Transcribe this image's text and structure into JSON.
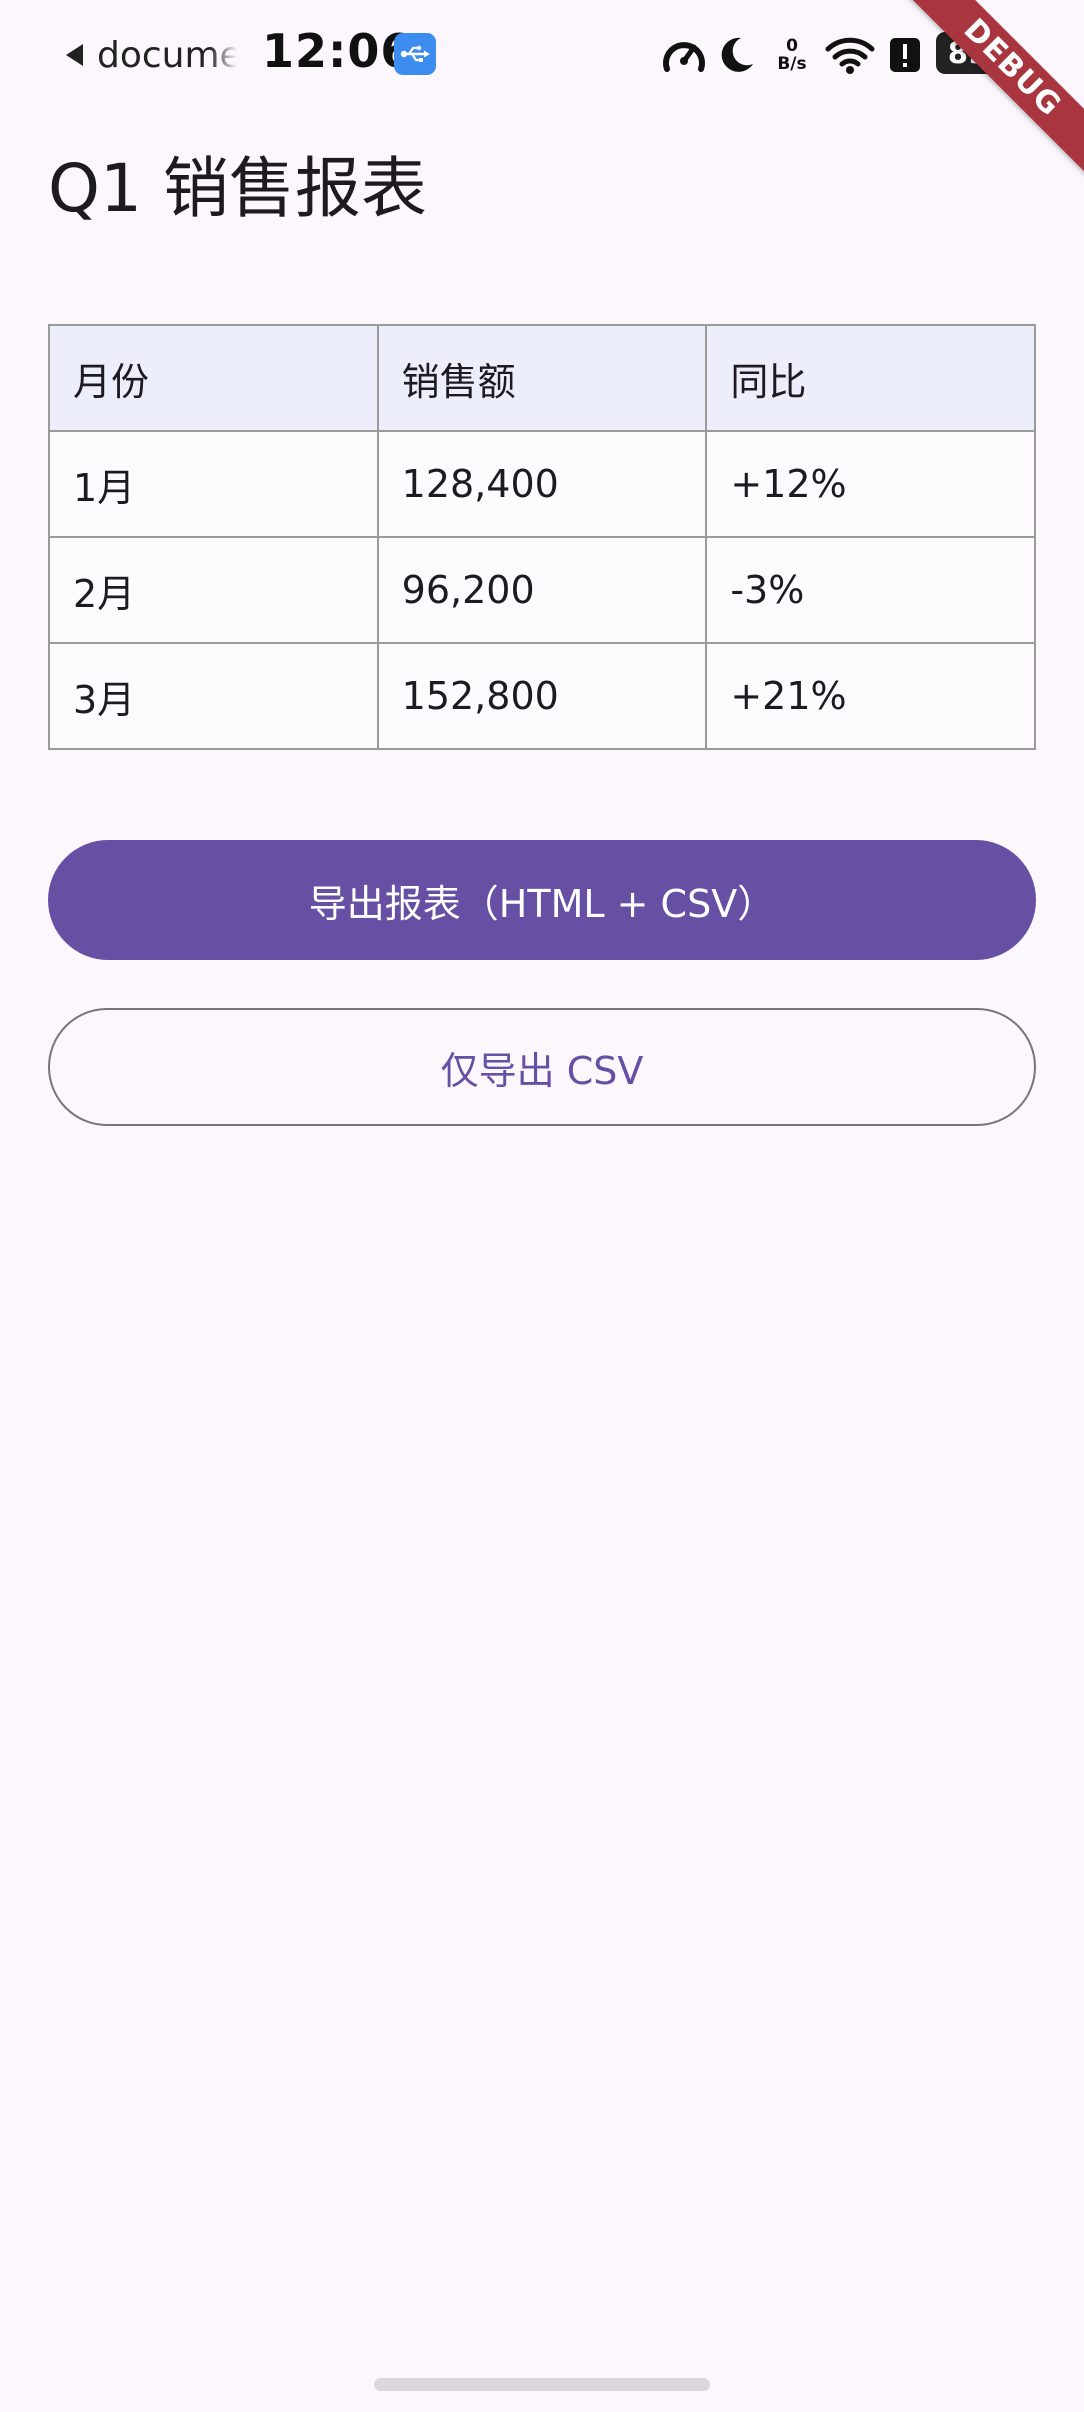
{
  "status_bar": {
    "back_app_label": "documen",
    "time": "12:06",
    "net_speed_value": "0",
    "net_speed_unit": "B/s",
    "battery_level": "89"
  },
  "debug_banner": "DEBUG",
  "page": {
    "title": "Q1 销售报表"
  },
  "table": {
    "headers": [
      "月份",
      "销售额",
      "同比"
    ],
    "rows": [
      [
        "1月",
        "128,400",
        "+12%"
      ],
      [
        "2月",
        "96,200",
        "-3%"
      ],
      [
        "3月",
        "152,800",
        "+21%"
      ]
    ]
  },
  "buttons": {
    "export_all_label": "导出报表（HTML + CSV）",
    "export_csv_label": "仅导出 CSV"
  },
  "colors": {
    "background": "#fcf6fd",
    "primary": "#6750a4",
    "table_header_bg": "#edeefc",
    "table_border": "#9a9a9a",
    "debug_ribbon": "#a9353f"
  },
  "icons": {
    "back": "back-arrow-icon",
    "usb": "usb-icon",
    "speed": "speedometer-icon",
    "dnd": "moon-icon",
    "wifi": "wifi-icon",
    "alert": "alert-icon",
    "battery": "battery-icon"
  }
}
